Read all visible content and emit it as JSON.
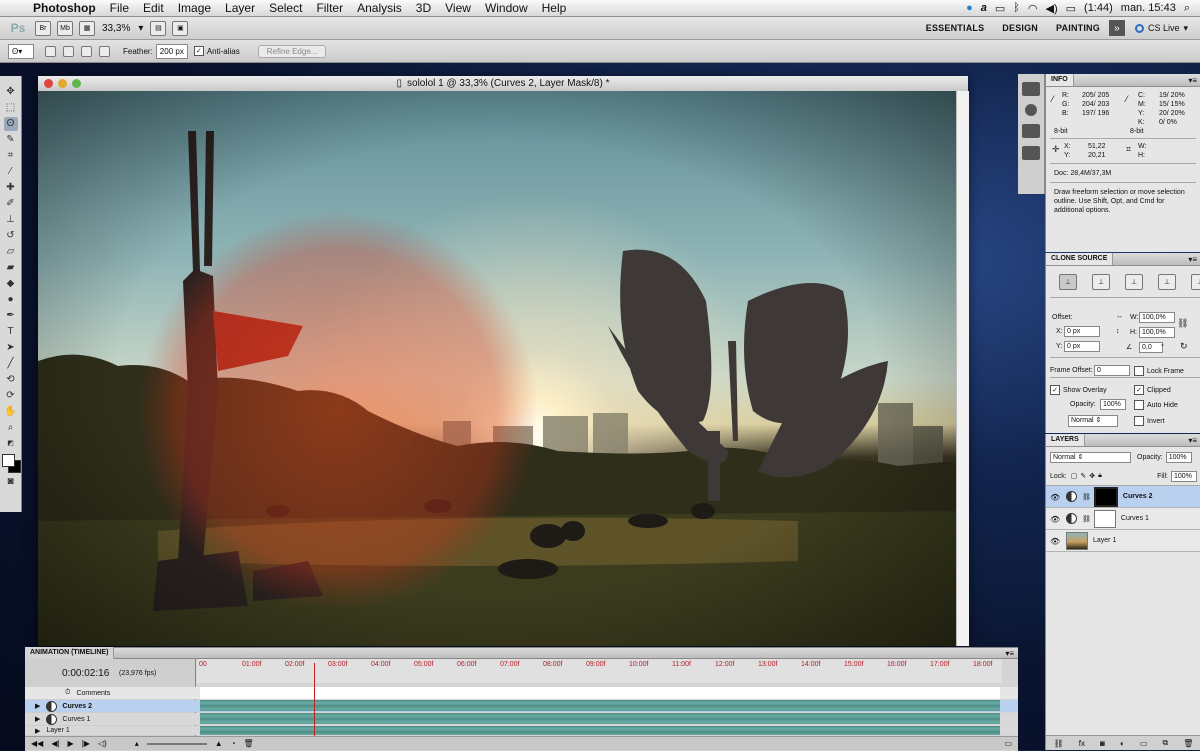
{
  "menubar": {
    "app_name": "Photoshop",
    "items": [
      "File",
      "Edit",
      "Image",
      "Layer",
      "Select",
      "Filter",
      "Analysis",
      "3D",
      "View",
      "Window",
      "Help"
    ],
    "battery": "(1:44)",
    "clock": "man. 15:43"
  },
  "appbar": {
    "zoom": "33,3%",
    "workspaces": [
      "ESSENTIALS",
      "DESIGN",
      "PAINTING"
    ],
    "cs_live": "CS Live"
  },
  "options": {
    "feather_label": "Feather:",
    "feather_value": "200 px",
    "anti_alias_label": "Anti-alias",
    "refine_edge": "Refine Edge..."
  },
  "document": {
    "title": "sololol 1 @ 33,3% (Curves 2, Layer Mask/8) *"
  },
  "info_panel": {
    "tab": "INFO",
    "r_label": "R:",
    "r_value": "205/ 205",
    "g_label": "G:",
    "g_value": "204/ 203",
    "b_label": "B:",
    "b_value": "197/ 196",
    "c_label": "C:",
    "c_value": "19/ 20%",
    "m_label": "M:",
    "m_value": "15/ 15%",
    "y_label": "Y:",
    "y_value": "20/ 20%",
    "k_label": "K:",
    "k_value": "0/ 0%",
    "bit_left": "8-bit",
    "bit_right": "8-bit",
    "x_label": "X:",
    "x_value": "51,22",
    "y2_label": "Y:",
    "y2_value": "20,21",
    "w_label": "W:",
    "h_label": "H:",
    "doc": "Doc: 28,4M/37,3M",
    "hint": "Draw freeform selection or move selection outline.  Use Shift, Opt, and Cmd for additional options."
  },
  "clone_panel": {
    "tab": "CLONE SOURCE",
    "offset_label": "Offset:",
    "x_label": "X:",
    "x_value": "0 px",
    "y_label": "Y:",
    "y_value": "0 px",
    "w_label": "W:",
    "w_value": "100,0%",
    "h_label": "H:",
    "h_value": "100,0%",
    "angle_value": "0,0",
    "angle_unit": "°",
    "frame_offset_label": "Frame Offset:",
    "frame_offset_value": "0",
    "lock_frame": "Lock Frame",
    "show_overlay": "Show Overlay",
    "clipped": "Clipped",
    "opacity_label": "Opacity:",
    "opacity_value": "100%",
    "auto_hide": "Auto Hide",
    "blend": "Normal",
    "invert": "Invert"
  },
  "layers_panel": {
    "tab": "LAYERS",
    "blend": "Normal",
    "opacity_label": "Opacity:",
    "opacity_value": "100%",
    "lock_label": "Lock:",
    "fill_label": "Fill:",
    "fill_value": "100%",
    "layers": [
      {
        "name": "Curves 2",
        "selected": true
      },
      {
        "name": "Curves 1",
        "selected": false
      },
      {
        "name": "Layer 1",
        "selected": false
      }
    ]
  },
  "timeline": {
    "tab": "ANIMATION (TIMELINE)",
    "timecode": "0:00:02:16",
    "fps": "(23,976 fps)",
    "ruler": [
      "00",
      "01:00f",
      "02:00f",
      "03:00f",
      "04:00f",
      "05:00f",
      "06:00f",
      "07:00f",
      "08:00f",
      "09:00f",
      "10:00f",
      "11:00f",
      "12:00f",
      "13:00f",
      "14:00f",
      "15:00f",
      "16:00f",
      "17:00f",
      "18:00f"
    ],
    "comments": "Comments",
    "tracks": [
      "Curves 2",
      "Curves 1",
      "Layer 1"
    ]
  },
  "colors": {
    "accent_selected": "#b9d1ef",
    "timeline_bar": "#5c9c95",
    "playhead": "#c02020"
  }
}
